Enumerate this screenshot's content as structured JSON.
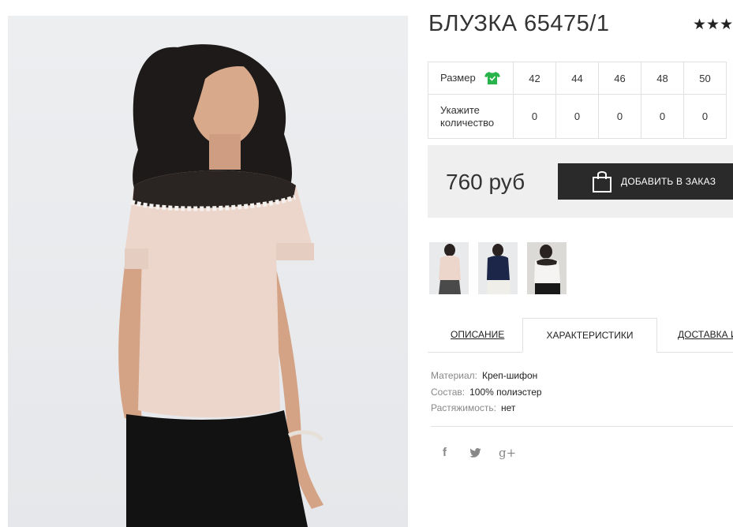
{
  "product": {
    "title": "БЛУЗКА 65475/1",
    "rating_stars": "★★★"
  },
  "sizes_table": {
    "size_label": "Размер",
    "quantity_label_line1": "Укажите",
    "quantity_label_line2": "количество",
    "sizes": [
      "42",
      "44",
      "46",
      "48",
      "50"
    ],
    "quantities": [
      "0",
      "0",
      "0",
      "0",
      "0"
    ]
  },
  "purchase": {
    "price": "760 руб",
    "add_to_order_label": "ДОБАВИТЬ В ЗАКАЗ"
  },
  "thumbnails": [
    "beige-blouse",
    "navy-blouse",
    "white-blouse"
  ],
  "tabs": {
    "description": "ОПИСАНИЕ",
    "characteristics": "ХАРАКТЕРИСТИКИ",
    "delivery": "ДОСТАВКА И"
  },
  "characteristics": [
    {
      "key": "Материал:",
      "value": "Креп-шифон"
    },
    {
      "key": "Состав:",
      "value": "100% полиэстер"
    },
    {
      "key": "Растяжимость:",
      "value": "нет"
    }
  ],
  "social": {
    "facebook": "f",
    "twitter": "twitter-icon",
    "googleplus": "g+"
  },
  "colors": {
    "button_bg": "#2a2a2a",
    "price_box_bg": "#efefef",
    "accent_green": "#27b24a"
  }
}
